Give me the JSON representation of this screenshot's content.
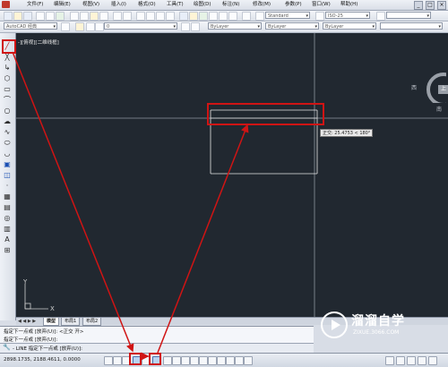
{
  "menu": {
    "items": [
      "文件(F)",
      "编辑(E)",
      "视图(V)",
      "插入(I)",
      "格式(O)",
      "工具(T)",
      "绘图(D)",
      "标注(N)",
      "修改(M)",
      "参数(P)",
      "窗口(W)",
      "帮助(H)"
    ],
    "window_buttons": [
      "_",
      "□",
      "×"
    ]
  },
  "toolbar": {
    "text_style": "Standard",
    "dim_style": "ISO-25",
    "workspace": "AutoCAD 经典",
    "layer": "0",
    "color": "ByLayer",
    "linetype": "ByLayer",
    "lineweight": "ByLayer"
  },
  "canvas": {
    "view_label": "-][俯视][二维线框]",
    "dynamic_input": "正交: 25.4753 < 180°",
    "viewcube": {
      "west": "西",
      "top": "上",
      "south": "南"
    },
    "ucs_x": "X",
    "ucs_y": "Y"
  },
  "tabs": {
    "nav": "◀ ◀ ▶ ▶",
    "items": [
      "模型",
      "布局1",
      "布局2"
    ]
  },
  "command": {
    "history_1": "指定下一点或 [放弃(U)]:  <正交 开>",
    "history_2": "指定下一点或 [放弃(U)]:",
    "prompt": "- LINE 指定下一点或 [放弃(U)]:"
  },
  "status": {
    "coordinates": "2898.1735, 2188.4611, 0.0000"
  },
  "watermark": {
    "title": "溜溜自学",
    "url": "ZIXUE.3066.COM"
  },
  "colors": {
    "canvas_bg": "#212830",
    "annotation_red": "#d01414",
    "line_white": "#e6e6e6"
  }
}
